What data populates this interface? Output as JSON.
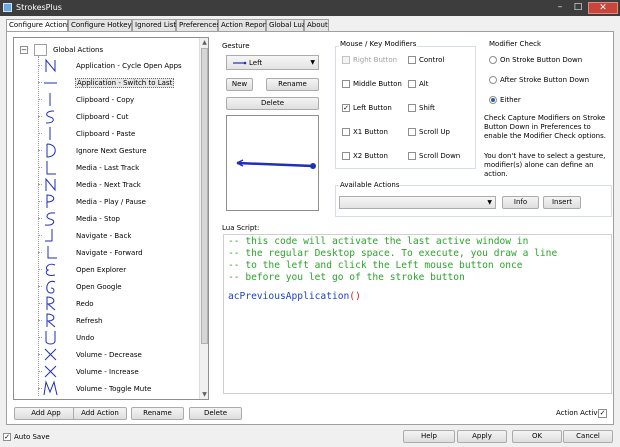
{
  "window": {
    "title": "StrokesPlus",
    "minimize": "–",
    "maximize": "□",
    "close": "✕"
  },
  "tabs": [
    {
      "label": "Configure Actions",
      "active": true
    },
    {
      "label": "Configure Hotkeys"
    },
    {
      "label": "Ignored List"
    },
    {
      "label": "Preferences"
    },
    {
      "label": "Action Report"
    },
    {
      "label": "Global Lua"
    },
    {
      "label": "About"
    }
  ],
  "tree": {
    "expander": "−",
    "root_label": "Global Actions",
    "items": [
      {
        "label": "Application - Cycle Open Apps",
        "icon": "n-gesture-icon"
      },
      {
        "label": "Application - Switch to Last",
        "icon": "left-line-gesture-icon",
        "selected": true
      },
      {
        "label": "Clipboard - Copy",
        "icon": "down-line-gesture-icon"
      },
      {
        "label": "Clipboard - Cut",
        "icon": "s-loop-gesture-icon"
      },
      {
        "label": "Clipboard - Paste",
        "icon": "down-line-gesture-icon"
      },
      {
        "label": "Ignore Next Gesture",
        "icon": "d-gesture-icon"
      },
      {
        "label": "Media - Last Track",
        "icon": "l-gesture-icon"
      },
      {
        "label": "Media - Next Track",
        "icon": "n-gesture-icon"
      },
      {
        "label": "Media - Play / Pause",
        "icon": "p-gesture-icon"
      },
      {
        "label": "Media - Stop",
        "icon": "s-gesture-icon"
      },
      {
        "label": "Navigate - Back",
        "icon": "down-left-gesture-icon"
      },
      {
        "label": "Navigate - Forward",
        "icon": "down-right-gesture-icon"
      },
      {
        "label": "Open Explorer",
        "icon": "e-gesture-icon"
      },
      {
        "label": "Open Google",
        "icon": "g-gesture-icon"
      },
      {
        "label": "Redo",
        "icon": "r-gesture-icon"
      },
      {
        "label": "Refresh",
        "icon": "r-gesture-icon"
      },
      {
        "label": "Undo",
        "icon": "u-gesture-icon"
      },
      {
        "label": "Volume - Decrease",
        "icon": "x-gesture-icon"
      },
      {
        "label": "Volume - Increase",
        "icon": "x-gesture-icon"
      },
      {
        "label": "Volume - Toggle Mute",
        "icon": "m-gesture-icon"
      },
      {
        "label": "",
        "icon": "partial-gesture-icon"
      }
    ]
  },
  "gesture": {
    "label": "Gesture",
    "selected": "Left",
    "new_label": "New",
    "rename_label": "Rename",
    "delete_label": "Delete"
  },
  "modifiers": {
    "title": "Mouse / Key Modifiers",
    "items": [
      {
        "label": "Right Button",
        "checked": false,
        "disabled": true
      },
      {
        "label": "Control",
        "checked": false
      },
      {
        "label": "Middle Button",
        "checked": false
      },
      {
        "label": "Alt",
        "checked": false
      },
      {
        "label": "Left Button",
        "checked": true
      },
      {
        "label": "Shift",
        "checked": false
      },
      {
        "label": "X1 Button",
        "checked": false
      },
      {
        "label": "Scroll Up",
        "checked": false
      },
      {
        "label": "X2 Button",
        "checked": false
      },
      {
        "label": "Scroll Down",
        "checked": false
      }
    ],
    "check_mark": "✓"
  },
  "modifier_check": {
    "title": "Modifier Check",
    "options": [
      {
        "label": "On Stroke Button Down",
        "selected": false
      },
      {
        "label": "After Stroke Button Down",
        "selected": false
      },
      {
        "label": "Either",
        "selected": true
      }
    ],
    "help1": "Check Capture Modifiers on Stroke Button Down in Preferences to enable the Modifier Check options.",
    "help2": "You don't have to select a gesture, modifier(s) alone can define an action."
  },
  "available_actions": {
    "label": "Available Actions",
    "value": "",
    "info_label": "Info",
    "insert_label": "Insert"
  },
  "lua": {
    "label": "Lua Script:",
    "lines": [
      "-- this code will activate the last active window in",
      "-- the regular Desktop space. To execute, you draw a line",
      "-- to the left and click the Left mouse button once",
      "-- before you let go of the stroke button"
    ],
    "code": "acPreviousApplication",
    "parens": "()"
  },
  "footer_buttons": {
    "add_app": "Add App",
    "add_action": "Add Action",
    "rename": "Rename",
    "delete": "Delete"
  },
  "action_active": {
    "label": "Action Active",
    "checked": true
  },
  "bottom": {
    "auto_save": "Auto Save",
    "help": "Help",
    "apply": "Apply",
    "ok": "OK",
    "cancel": "Cancel"
  },
  "colors": {
    "gesture_stroke": "#1f2fb8",
    "comment": "#2aa52a",
    "code": "#1e42c8"
  }
}
